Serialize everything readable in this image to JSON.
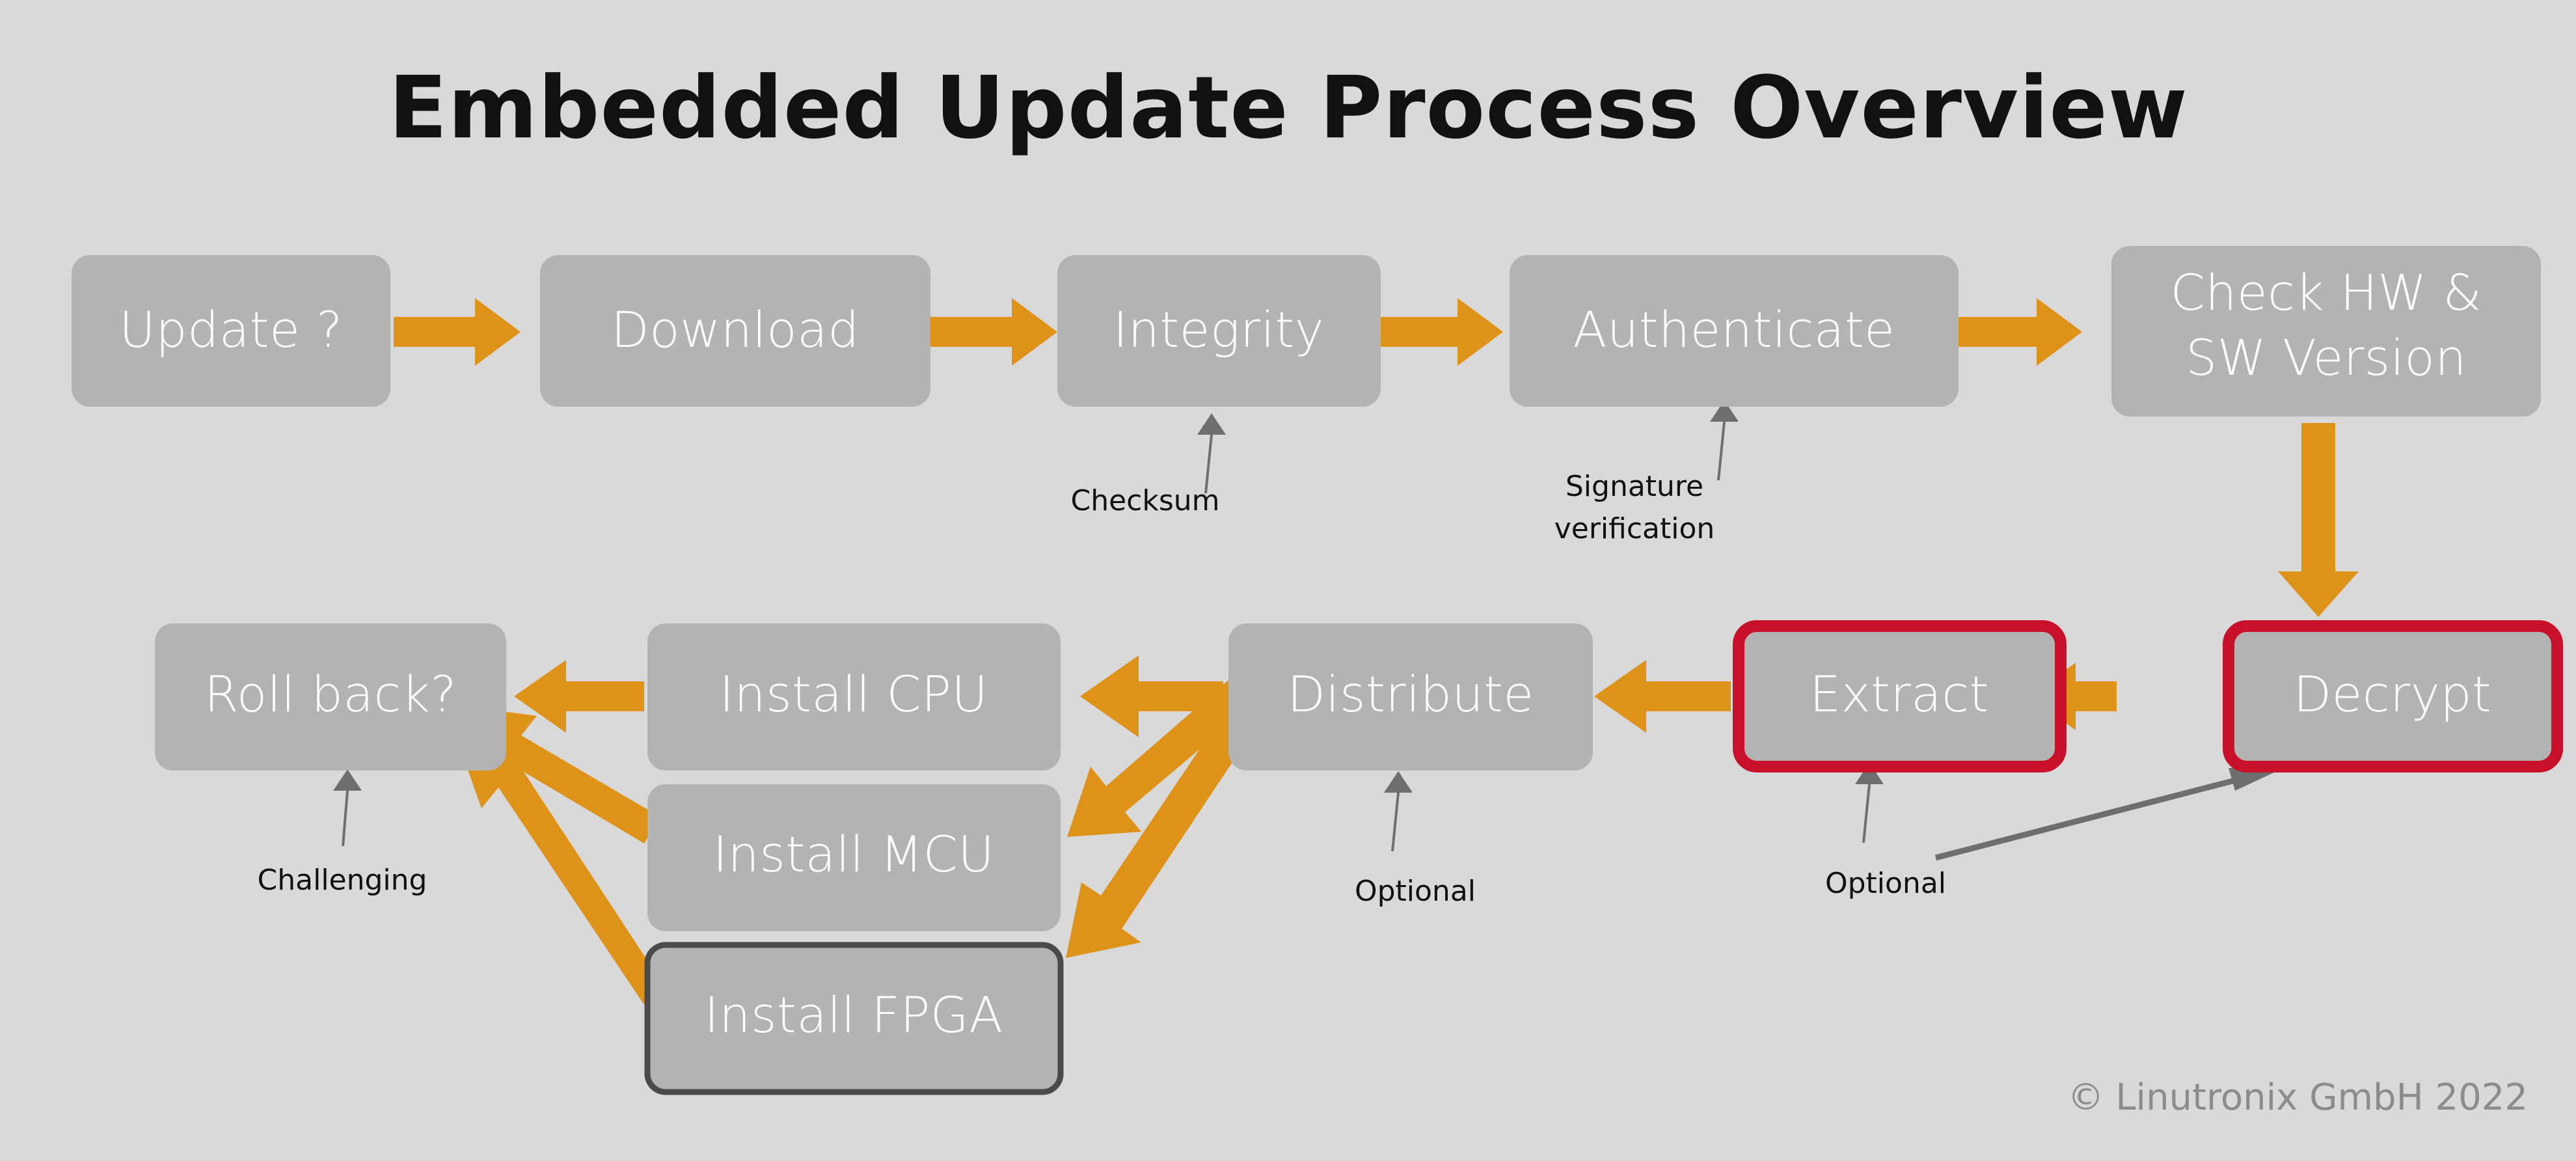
{
  "page": {
    "title": "Embedded Update Process Overview",
    "background_color": "#d9d9d9",
    "footer": "© Linutronix GmbH 2022"
  },
  "colors": {
    "box_fill": "#b3b3b3",
    "box_text": "#ffffff",
    "flow_arrow": "#df9218",
    "highlight_border": "#c8102a",
    "emphasis_border": "#4a4a4a",
    "note_text": "#101010",
    "note_arrow": "#6e6e6e",
    "footer_text": "#8c8c8c"
  },
  "nodes": [
    {
      "id": "update",
      "label": "Update ?",
      "border": "none"
    },
    {
      "id": "download",
      "label": "Download",
      "border": "none"
    },
    {
      "id": "integrity",
      "label": "Integrity",
      "border": "none"
    },
    {
      "id": "authenticate",
      "label": "Authenticate",
      "border": "none"
    },
    {
      "id": "checkhw",
      "label_line1": "Check HW &",
      "label_line2": "SW Version",
      "border": "none"
    },
    {
      "id": "decrypt",
      "label": "Decrypt",
      "border": "red"
    },
    {
      "id": "extract",
      "label": "Extract",
      "border": "red"
    },
    {
      "id": "distribute",
      "label": "Distribute",
      "border": "none"
    },
    {
      "id": "install_cpu",
      "label": "Install CPU",
      "border": "none"
    },
    {
      "id": "install_mcu",
      "label": "Install MCU",
      "border": "none"
    },
    {
      "id": "install_fpga",
      "label": "Install FPGA",
      "border": "dark"
    },
    {
      "id": "rollback",
      "label": "Roll back?",
      "border": "none"
    }
  ],
  "notes": [
    {
      "id": "checksum",
      "label": "Checksum",
      "target": "integrity"
    },
    {
      "id": "signature",
      "label_line1": "Signature",
      "label_line2": "verification",
      "target": "authenticate"
    },
    {
      "id": "optional_distribute",
      "label": "Optional",
      "target": "distribute"
    },
    {
      "id": "optional_extract",
      "label": "Optional",
      "target": "extract"
    },
    {
      "id": "challenging",
      "label": "Challenging",
      "target": "rollback"
    }
  ],
  "chart_data": {
    "type": "diagram",
    "title": "Embedded Update Process Overview",
    "flow": [
      {
        "from": "Update ?",
        "to": "Download"
      },
      {
        "from": "Download",
        "to": "Integrity"
      },
      {
        "from": "Integrity",
        "to": "Authenticate"
      },
      {
        "from": "Authenticate",
        "to": "Check HW & SW Version"
      },
      {
        "from": "Check HW & SW Version",
        "to": "Decrypt"
      },
      {
        "from": "Decrypt",
        "to": "Extract"
      },
      {
        "from": "Extract",
        "to": "Distribute"
      },
      {
        "from": "Distribute",
        "to": "Install CPU"
      },
      {
        "from": "Distribute",
        "to": "Install MCU"
      },
      {
        "from": "Distribute",
        "to": "Install FPGA"
      },
      {
        "from": "Install CPU",
        "to": "Roll back?"
      },
      {
        "from": "Install MCU",
        "to": "Roll back?"
      },
      {
        "from": "Install FPGA",
        "to": "Roll back?"
      }
    ],
    "annotations": [
      {
        "node": "Integrity",
        "text": "Checksum"
      },
      {
        "node": "Authenticate",
        "text": "Signature verification"
      },
      {
        "node": "Distribute",
        "text": "Optional"
      },
      {
        "node": "Extract",
        "text": "Optional"
      },
      {
        "node": "Decrypt",
        "text": "Optional"
      },
      {
        "node": "Roll back?",
        "text": "Challenging"
      }
    ]
  }
}
